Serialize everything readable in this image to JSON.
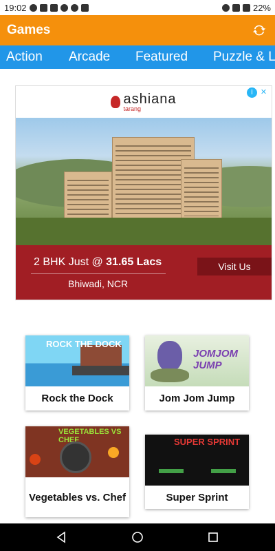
{
  "status": {
    "time": "19:02",
    "battery": "22%"
  },
  "app": {
    "title": "Games"
  },
  "tabs": [
    {
      "label": "Action"
    },
    {
      "label": "Arcade"
    },
    {
      "label": "Featured"
    },
    {
      "label": "Puzzle & L"
    }
  ],
  "ad": {
    "brand": "ashiana",
    "brand_sub": "tarang",
    "price_prefix": "2 BHK Just @ ",
    "price_value": "31.65 Lacs",
    "location": "Bhiwadi, NCR",
    "cta": "Visit Us"
  },
  "games": [
    {
      "title": "Rock the Dock",
      "thumb_text": "ROCK THE DOCK"
    },
    {
      "title": "Jom Jom Jump",
      "thumb_text": "JOMJOM JUMP"
    },
    {
      "title": "Vegetables vs. Chef",
      "thumb_text": "VEGETABLES VS CHEF"
    },
    {
      "title": "Super Sprint",
      "thumb_text": "SUPER SPRINT"
    }
  ],
  "colors": {
    "app_bar": "#f5900c",
    "tab_bar": "#2196e8",
    "ad_footer": "#a11e24"
  }
}
